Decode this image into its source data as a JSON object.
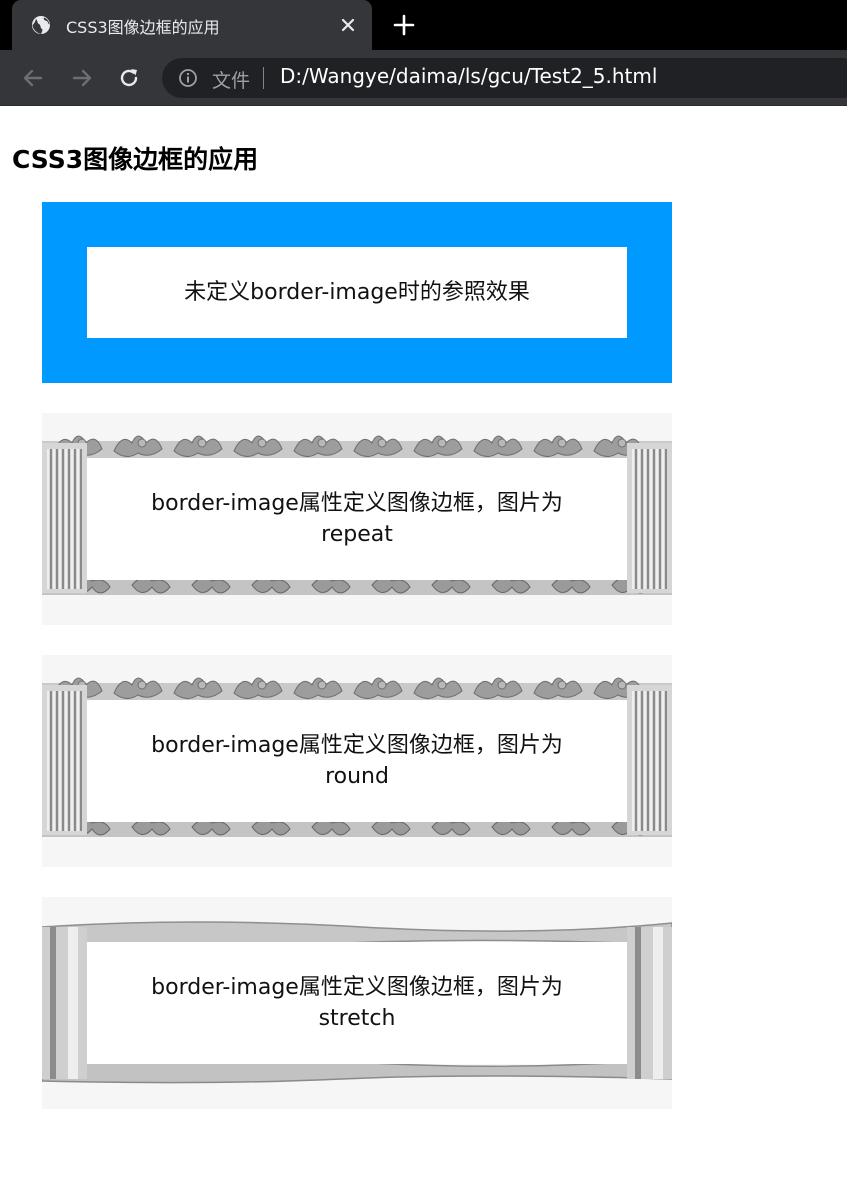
{
  "browser": {
    "tab_title": "CSS3图像边框的应用",
    "security_chip": "文件",
    "url": "D:/Wangye/daima/ls/gcu/Test2_5.html",
    "colors": {
      "tabstrip": "#000000",
      "toolbar": "#35363a",
      "omnibox": "#202124"
    }
  },
  "page": {
    "title": "CSS3图像边框的应用",
    "boxes": [
      {
        "text": "未定义border-image时的参照效果",
        "border_color": "#0099ff"
      },
      {
        "text": "border-image属性定义图像边框，图片为repeat",
        "mode": "repeat"
      },
      {
        "text": "border-image属性定义图像边框，图片为round",
        "mode": "round"
      },
      {
        "text": "border-image属性定义图像边框，图片为stretch",
        "mode": "stretch"
      }
    ]
  }
}
